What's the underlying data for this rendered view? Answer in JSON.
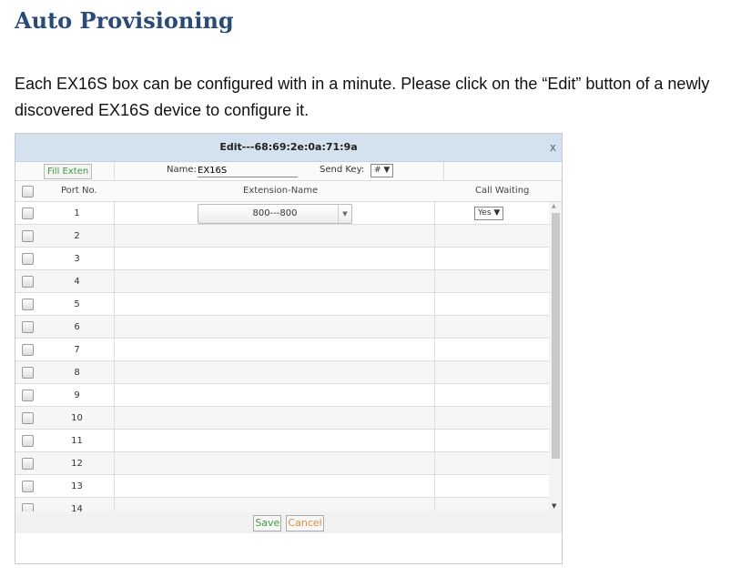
{
  "document": {
    "title": "Auto Provisioning",
    "paragraph": "Each EX16S box can be configured with in a minute. Please click on the “Edit” button of a newly discovered EX16S device to configure it."
  },
  "dialog": {
    "title": "Edit---68:69:2e:0a:71:9a",
    "close": "x",
    "fill_button": "Fill Exten",
    "name_label": "Name:",
    "name_value": "EX16S",
    "send_key_label": "Send Key:",
    "send_key_value": "#",
    "columns": {
      "port": "Port No.",
      "extension": "Extension-Name",
      "call_waiting": "Call Waiting"
    },
    "rows": [
      {
        "port": "1",
        "extension": "800---800",
        "call_waiting": "Yes"
      },
      {
        "port": "2"
      },
      {
        "port": "3"
      },
      {
        "port": "4"
      },
      {
        "port": "5"
      },
      {
        "port": "6"
      },
      {
        "port": "7"
      },
      {
        "port": "8"
      },
      {
        "port": "9"
      },
      {
        "port": "10"
      },
      {
        "port": "11"
      },
      {
        "port": "12"
      },
      {
        "port": "13"
      },
      {
        "port": "14"
      }
    ],
    "save": "Save",
    "cancel": "Cancel"
  },
  "icons": {
    "dropdown": "triangle-down-icon",
    "scroll_up": "triangle-up-icon",
    "scroll_down": "triangle-down-icon"
  }
}
